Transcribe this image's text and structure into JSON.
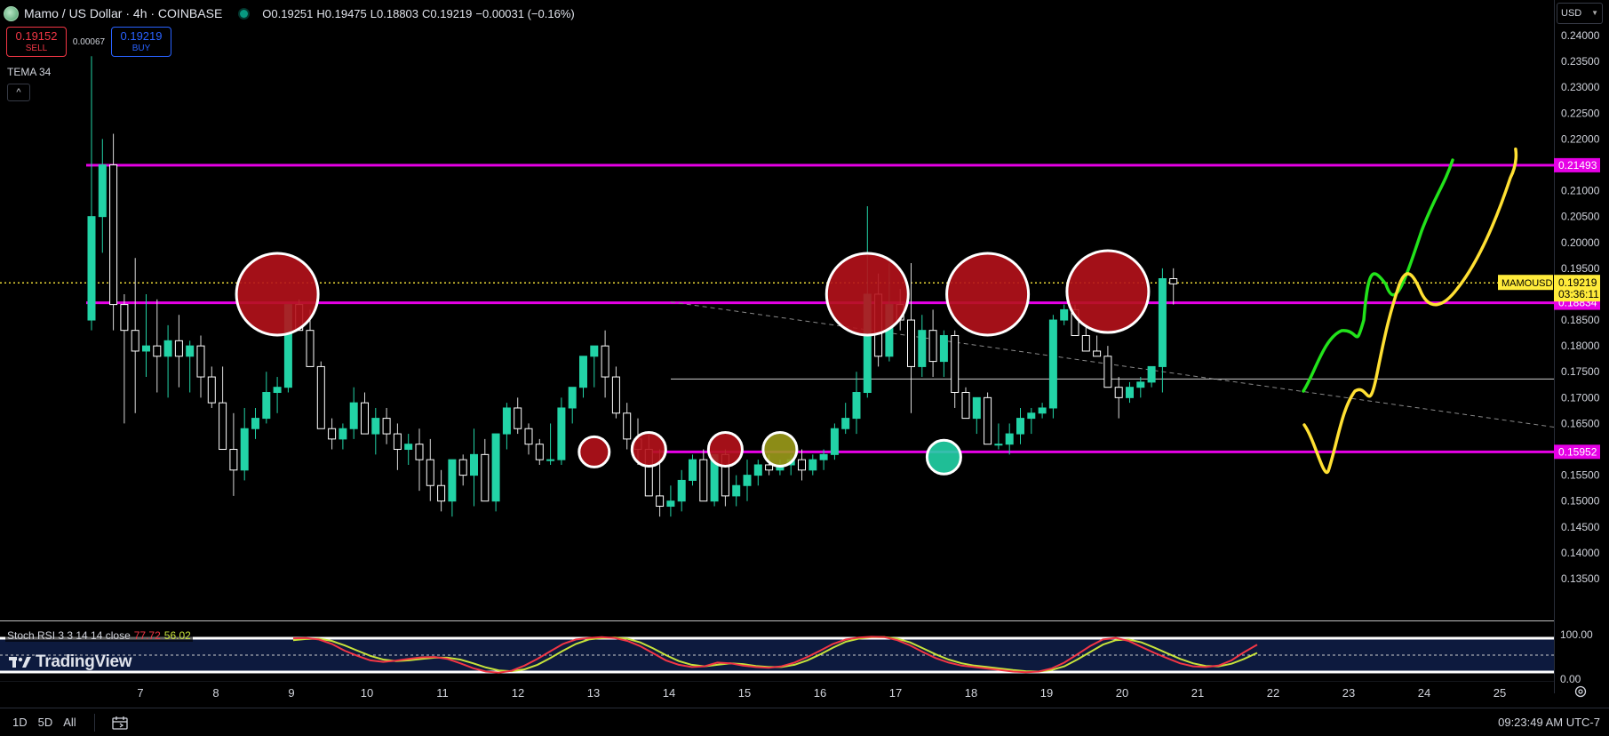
{
  "header": {
    "title": "Mamo / US Dollar · 4h · COINBASE",
    "ohlc": {
      "open": "O0.19251",
      "high": "H0.19475",
      "low": "L0.18803",
      "close": "C0.19219",
      "change": "−0.00031 (−0.16%)"
    }
  },
  "trade": {
    "sell_price": "0.19152",
    "sell_label": "SELL",
    "spread": "0.00067",
    "buy_price": "0.19219",
    "buy_label": "BUY"
  },
  "indicators": {
    "tema_label": "TEMA 34",
    "collapse_glyph": "^",
    "rsi_label": "Stoch RSI 3 3 14 14 close",
    "rsi_k": "77.72",
    "rsi_d": "56.02"
  },
  "price_scale": {
    "currency": "USD",
    "ticks": [
      "0.24000",
      "0.23500",
      "0.23000",
      "0.22500",
      "0.22000",
      "0.21500",
      "0.21000",
      "0.20500",
      "0.20000",
      "0.19500",
      "0.19000",
      "0.18500",
      "0.18000",
      "0.17500",
      "0.17000",
      "0.16500",
      "0.16000",
      "0.15500",
      "0.15000",
      "0.14500",
      "0.14000",
      "0.13500"
    ],
    "rsi_ticks": [
      "100.00",
      "0.00"
    ],
    "badges": {
      "resistance_high": "0.21493",
      "resistance_mid": "0.18834",
      "support": "0.15952",
      "symbol": "MAMOUSD",
      "last_price": "0.19219",
      "countdown": "03:36:11"
    }
  },
  "time_axis": {
    "labels": [
      "7",
      "8",
      "9",
      "10",
      "11",
      "12",
      "13",
      "14",
      "15",
      "16",
      "17",
      "18",
      "19",
      "20",
      "21",
      "22",
      "23",
      "24",
      "25"
    ]
  },
  "bottom_bar": {
    "ranges": [
      "1D",
      "5D",
      "All"
    ],
    "clock": "09:23:49 AM UTC-7"
  },
  "branding": {
    "logo_text": "TradingView"
  },
  "colors": {
    "up": "#22d3a6",
    "down": "#ffffff",
    "level_line": "#e600e6",
    "price_line": "#ffeb3b",
    "circle_fill": "#b5121b",
    "path_green": "#22e31b",
    "path_yellow": "#ffe033",
    "rsi_k": "#f23645",
    "rsi_d": "#c7e33b"
  },
  "chart_data": {
    "type": "candlestick",
    "title": "Mamo / US Dollar · 4h · COINBASE",
    "ylim": [
      0.132,
      0.241
    ],
    "ohlc": [
      [
        0.185,
        0.236,
        0.183,
        0.205
      ],
      [
        0.205,
        0.22,
        0.198,
        0.215
      ],
      [
        0.215,
        0.221,
        0.183,
        0.188
      ],
      [
        0.188,
        0.19,
        0.165,
        0.183
      ],
      [
        0.183,
        0.197,
        0.167,
        0.179
      ],
      [
        0.179,
        0.19,
        0.174,
        0.18
      ],
      [
        0.18,
        0.189,
        0.171,
        0.178
      ],
      [
        0.178,
        0.184,
        0.17,
        0.181
      ],
      [
        0.181,
        0.186,
        0.172,
        0.178
      ],
      [
        0.178,
        0.181,
        0.171,
        0.18
      ],
      [
        0.18,
        0.182,
        0.17,
        0.174
      ],
      [
        0.174,
        0.176,
        0.168,
        0.169
      ],
      [
        0.169,
        0.176,
        0.16,
        0.16
      ],
      [
        0.16,
        0.167,
        0.151,
        0.156
      ],
      [
        0.156,
        0.168,
        0.154,
        0.164
      ],
      [
        0.164,
        0.168,
        0.162,
        0.166
      ],
      [
        0.166,
        0.175,
        0.165,
        0.171
      ],
      [
        0.171,
        0.174,
        0.167,
        0.172
      ],
      [
        0.172,
        0.186,
        0.171,
        0.188
      ],
      [
        0.188,
        0.189,
        0.183,
        0.183
      ],
      [
        0.183,
        0.187,
        0.176,
        0.176
      ],
      [
        0.176,
        0.177,
        0.164,
        0.164
      ],
      [
        0.164,
        0.166,
        0.16,
        0.162
      ],
      [
        0.162,
        0.165,
        0.16,
        0.164
      ],
      [
        0.164,
        0.172,
        0.162,
        0.169
      ],
      [
        0.169,
        0.171,
        0.164,
        0.163
      ],
      [
        0.163,
        0.168,
        0.159,
        0.166
      ],
      [
        0.166,
        0.168,
        0.161,
        0.163
      ],
      [
        0.163,
        0.165,
        0.156,
        0.16
      ],
      [
        0.16,
        0.163,
        0.157,
        0.161
      ],
      [
        0.161,
        0.164,
        0.152,
        0.158
      ],
      [
        0.158,
        0.162,
        0.15,
        0.153
      ],
      [
        0.153,
        0.156,
        0.148,
        0.15
      ],
      [
        0.15,
        0.158,
        0.147,
        0.158
      ],
      [
        0.158,
        0.159,
        0.153,
        0.155
      ],
      [
        0.155,
        0.164,
        0.149,
        0.159
      ],
      [
        0.159,
        0.162,
        0.151,
        0.15
      ],
      [
        0.15,
        0.163,
        0.148,
        0.163
      ],
      [
        0.163,
        0.169,
        0.16,
        0.168
      ],
      [
        0.168,
        0.17,
        0.163,
        0.164
      ],
      [
        0.164,
        0.165,
        0.159,
        0.161
      ],
      [
        0.161,
        0.162,
        0.157,
        0.158
      ],
      [
        0.158,
        0.165,
        0.157,
        0.158
      ],
      [
        0.158,
        0.17,
        0.157,
        0.168
      ],
      [
        0.168,
        0.172,
        0.165,
        0.172
      ],
      [
        0.172,
        0.178,
        0.17,
        0.178
      ],
      [
        0.178,
        0.179,
        0.172,
        0.18
      ],
      [
        0.18,
        0.183,
        0.17,
        0.174
      ],
      [
        0.174,
        0.176,
        0.166,
        0.167
      ],
      [
        0.167,
        0.169,
        0.16,
        0.162
      ],
      [
        0.162,
        0.166,
        0.157,
        0.16
      ],
      [
        0.16,
        0.163,
        0.152,
        0.151
      ],
      [
        0.151,
        0.16,
        0.147,
        0.149
      ],
      [
        0.149,
        0.153,
        0.147,
        0.15
      ],
      [
        0.15,
        0.156,
        0.148,
        0.154
      ],
      [
        0.154,
        0.159,
        0.153,
        0.158
      ],
      [
        0.158,
        0.16,
        0.15,
        0.15
      ],
      [
        0.15,
        0.159,
        0.149,
        0.159
      ],
      [
        0.159,
        0.16,
        0.149,
        0.151
      ],
      [
        0.151,
        0.155,
        0.149,
        0.153
      ],
      [
        0.153,
        0.158,
        0.15,
        0.155
      ],
      [
        0.155,
        0.158,
        0.153,
        0.157
      ],
      [
        0.157,
        0.159,
        0.155,
        0.156
      ],
      [
        0.156,
        0.158,
        0.155,
        0.157
      ],
      [
        0.157,
        0.159,
        0.155,
        0.158
      ],
      [
        0.158,
        0.16,
        0.154,
        0.156
      ],
      [
        0.156,
        0.159,
        0.155,
        0.158
      ],
      [
        0.158,
        0.16,
        0.156,
        0.159
      ],
      [
        0.159,
        0.165,
        0.158,
        0.164
      ],
      [
        0.164,
        0.169,
        0.163,
        0.166
      ],
      [
        0.166,
        0.175,
        0.163,
        0.171
      ],
      [
        0.171,
        0.207,
        0.17,
        0.19
      ],
      [
        0.19,
        0.194,
        0.176,
        0.178
      ],
      [
        0.178,
        0.196,
        0.177,
        0.188
      ],
      [
        0.188,
        0.191,
        0.183,
        0.185
      ],
      [
        0.185,
        0.196,
        0.167,
        0.176
      ],
      [
        0.176,
        0.186,
        0.174,
        0.183
      ],
      [
        0.183,
        0.187,
        0.174,
        0.177
      ],
      [
        0.177,
        0.183,
        0.174,
        0.182
      ],
      [
        0.182,
        0.183,
        0.168,
        0.171
      ],
      [
        0.171,
        0.172,
        0.166,
        0.166
      ],
      [
        0.166,
        0.169,
        0.163,
        0.17
      ],
      [
        0.17,
        0.171,
        0.161,
        0.161
      ],
      [
        0.161,
        0.165,
        0.16,
        0.161
      ],
      [
        0.161,
        0.165,
        0.159,
        0.163
      ],
      [
        0.163,
        0.168,
        0.161,
        0.166
      ],
      [
        0.166,
        0.168,
        0.163,
        0.167
      ],
      [
        0.167,
        0.169,
        0.166,
        0.168
      ],
      [
        0.168,
        0.186,
        0.166,
        0.185
      ],
      [
        0.185,
        0.188,
        0.184,
        0.187
      ],
      [
        0.187,
        0.188,
        0.183,
        0.182
      ],
      [
        0.182,
        0.184,
        0.179,
        0.179
      ],
      [
        0.179,
        0.182,
        0.178,
        0.178
      ],
      [
        0.178,
        0.18,
        0.173,
        0.172
      ],
      [
        0.172,
        0.174,
        0.166,
        0.17
      ],
      [
        0.17,
        0.173,
        0.169,
        0.172
      ],
      [
        0.172,
        0.174,
        0.17,
        0.173
      ],
      [
        0.173,
        0.176,
        0.172,
        0.176
      ],
      [
        0.176,
        0.195,
        0.171,
        0.193
      ],
      [
        0.193,
        0.195,
        0.188,
        0.192
      ]
    ],
    "horizontal_levels": [
      0.21493,
      0.18834,
      0.15952
    ],
    "last_price": 0.19219,
    "rsi": {
      "ylim": [
        0,
        100
      ],
      "k": [
        95,
        96,
        92,
        80,
        62,
        48,
        36,
        32,
        35,
        40,
        44,
        45,
        40,
        28,
        15,
        6,
        3,
        8,
        22,
        40,
        60,
        80,
        92,
        96,
        98,
        96,
        88,
        74,
        55,
        36,
        24,
        18,
        20,
        30,
        28,
        22,
        18,
        16,
        20,
        30,
        45,
        62,
        80,
        92,
        97,
        99,
        98,
        90,
        76,
        58,
        42,
        30,
        22,
        18,
        14,
        10,
        6,
        4,
        6,
        14,
        30,
        52,
        74,
        92,
        96,
        88,
        72,
        56,
        42,
        28,
        20,
        18,
        22,
        36,
        58,
        78
      ],
      "d": [
        90,
        93,
        94,
        88,
        76,
        62,
        48,
        38,
        34,
        36,
        40,
        43,
        43,
        38,
        28,
        17,
        9,
        7,
        12,
        24,
        42,
        62,
        80,
        92,
        96,
        97,
        94,
        84,
        68,
        50,
        34,
        24,
        20,
        24,
        28,
        26,
        21,
        18,
        18,
        24,
        36,
        52,
        70,
        86,
        94,
        98,
        98,
        94,
        84,
        68,
        52,
        38,
        28,
        22,
        18,
        14,
        10,
        7,
        6,
        10,
        20,
        38,
        58,
        78,
        90,
        92,
        84,
        70,
        55,
        40,
        28,
        21,
        20,
        27,
        40,
        56
      ]
    }
  }
}
